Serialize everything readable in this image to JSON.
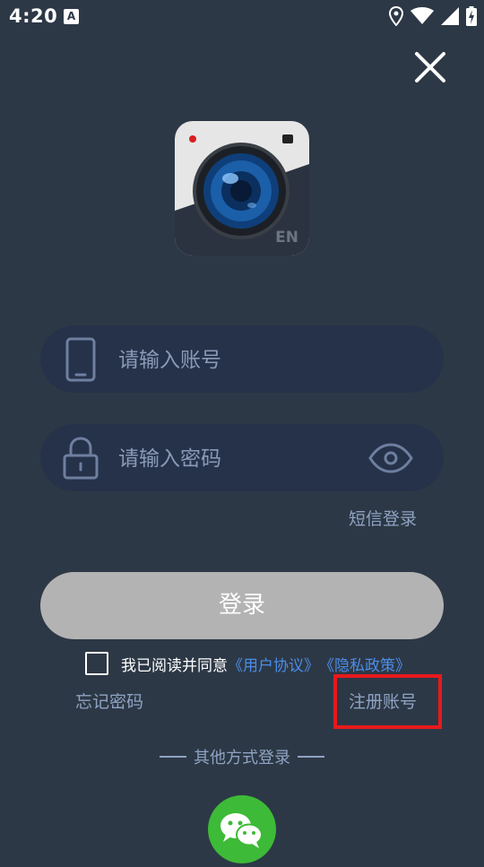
{
  "status_bar": {
    "time": "4:20",
    "notification_badge": "A",
    "icons": [
      "location-icon",
      "wifi-icon",
      "signal-icon",
      "battery-icon"
    ]
  },
  "close_icon": "close-icon",
  "app_logo": {
    "badge": "EN"
  },
  "account_field": {
    "placeholder": "请输入账号",
    "value": "",
    "icon": "phone-icon"
  },
  "password_field": {
    "placeholder": "请输入密码",
    "value": "",
    "icon": "lock-icon",
    "toggle_icon": "eye-icon"
  },
  "sms_login_label": "短信登录",
  "login_button_label": "登录",
  "agreement": {
    "checked": false,
    "text": "我已阅读并同意",
    "user_agreement": "《用户协议》",
    "privacy_policy": "《隐私政策》"
  },
  "forgot_password_label": "忘记密码",
  "register_label": "注册账号",
  "other_login_label": "其他方式登录",
  "wechat_icon": "wechat-icon",
  "colors": {
    "background": "#2d3846",
    "field_background": "#263249",
    "link": "#4a8de8",
    "secondary_text": "#8fa3c2",
    "login_button": "#b3b3b3",
    "wechat_green": "#3dba37",
    "highlight": "#e8191c"
  }
}
